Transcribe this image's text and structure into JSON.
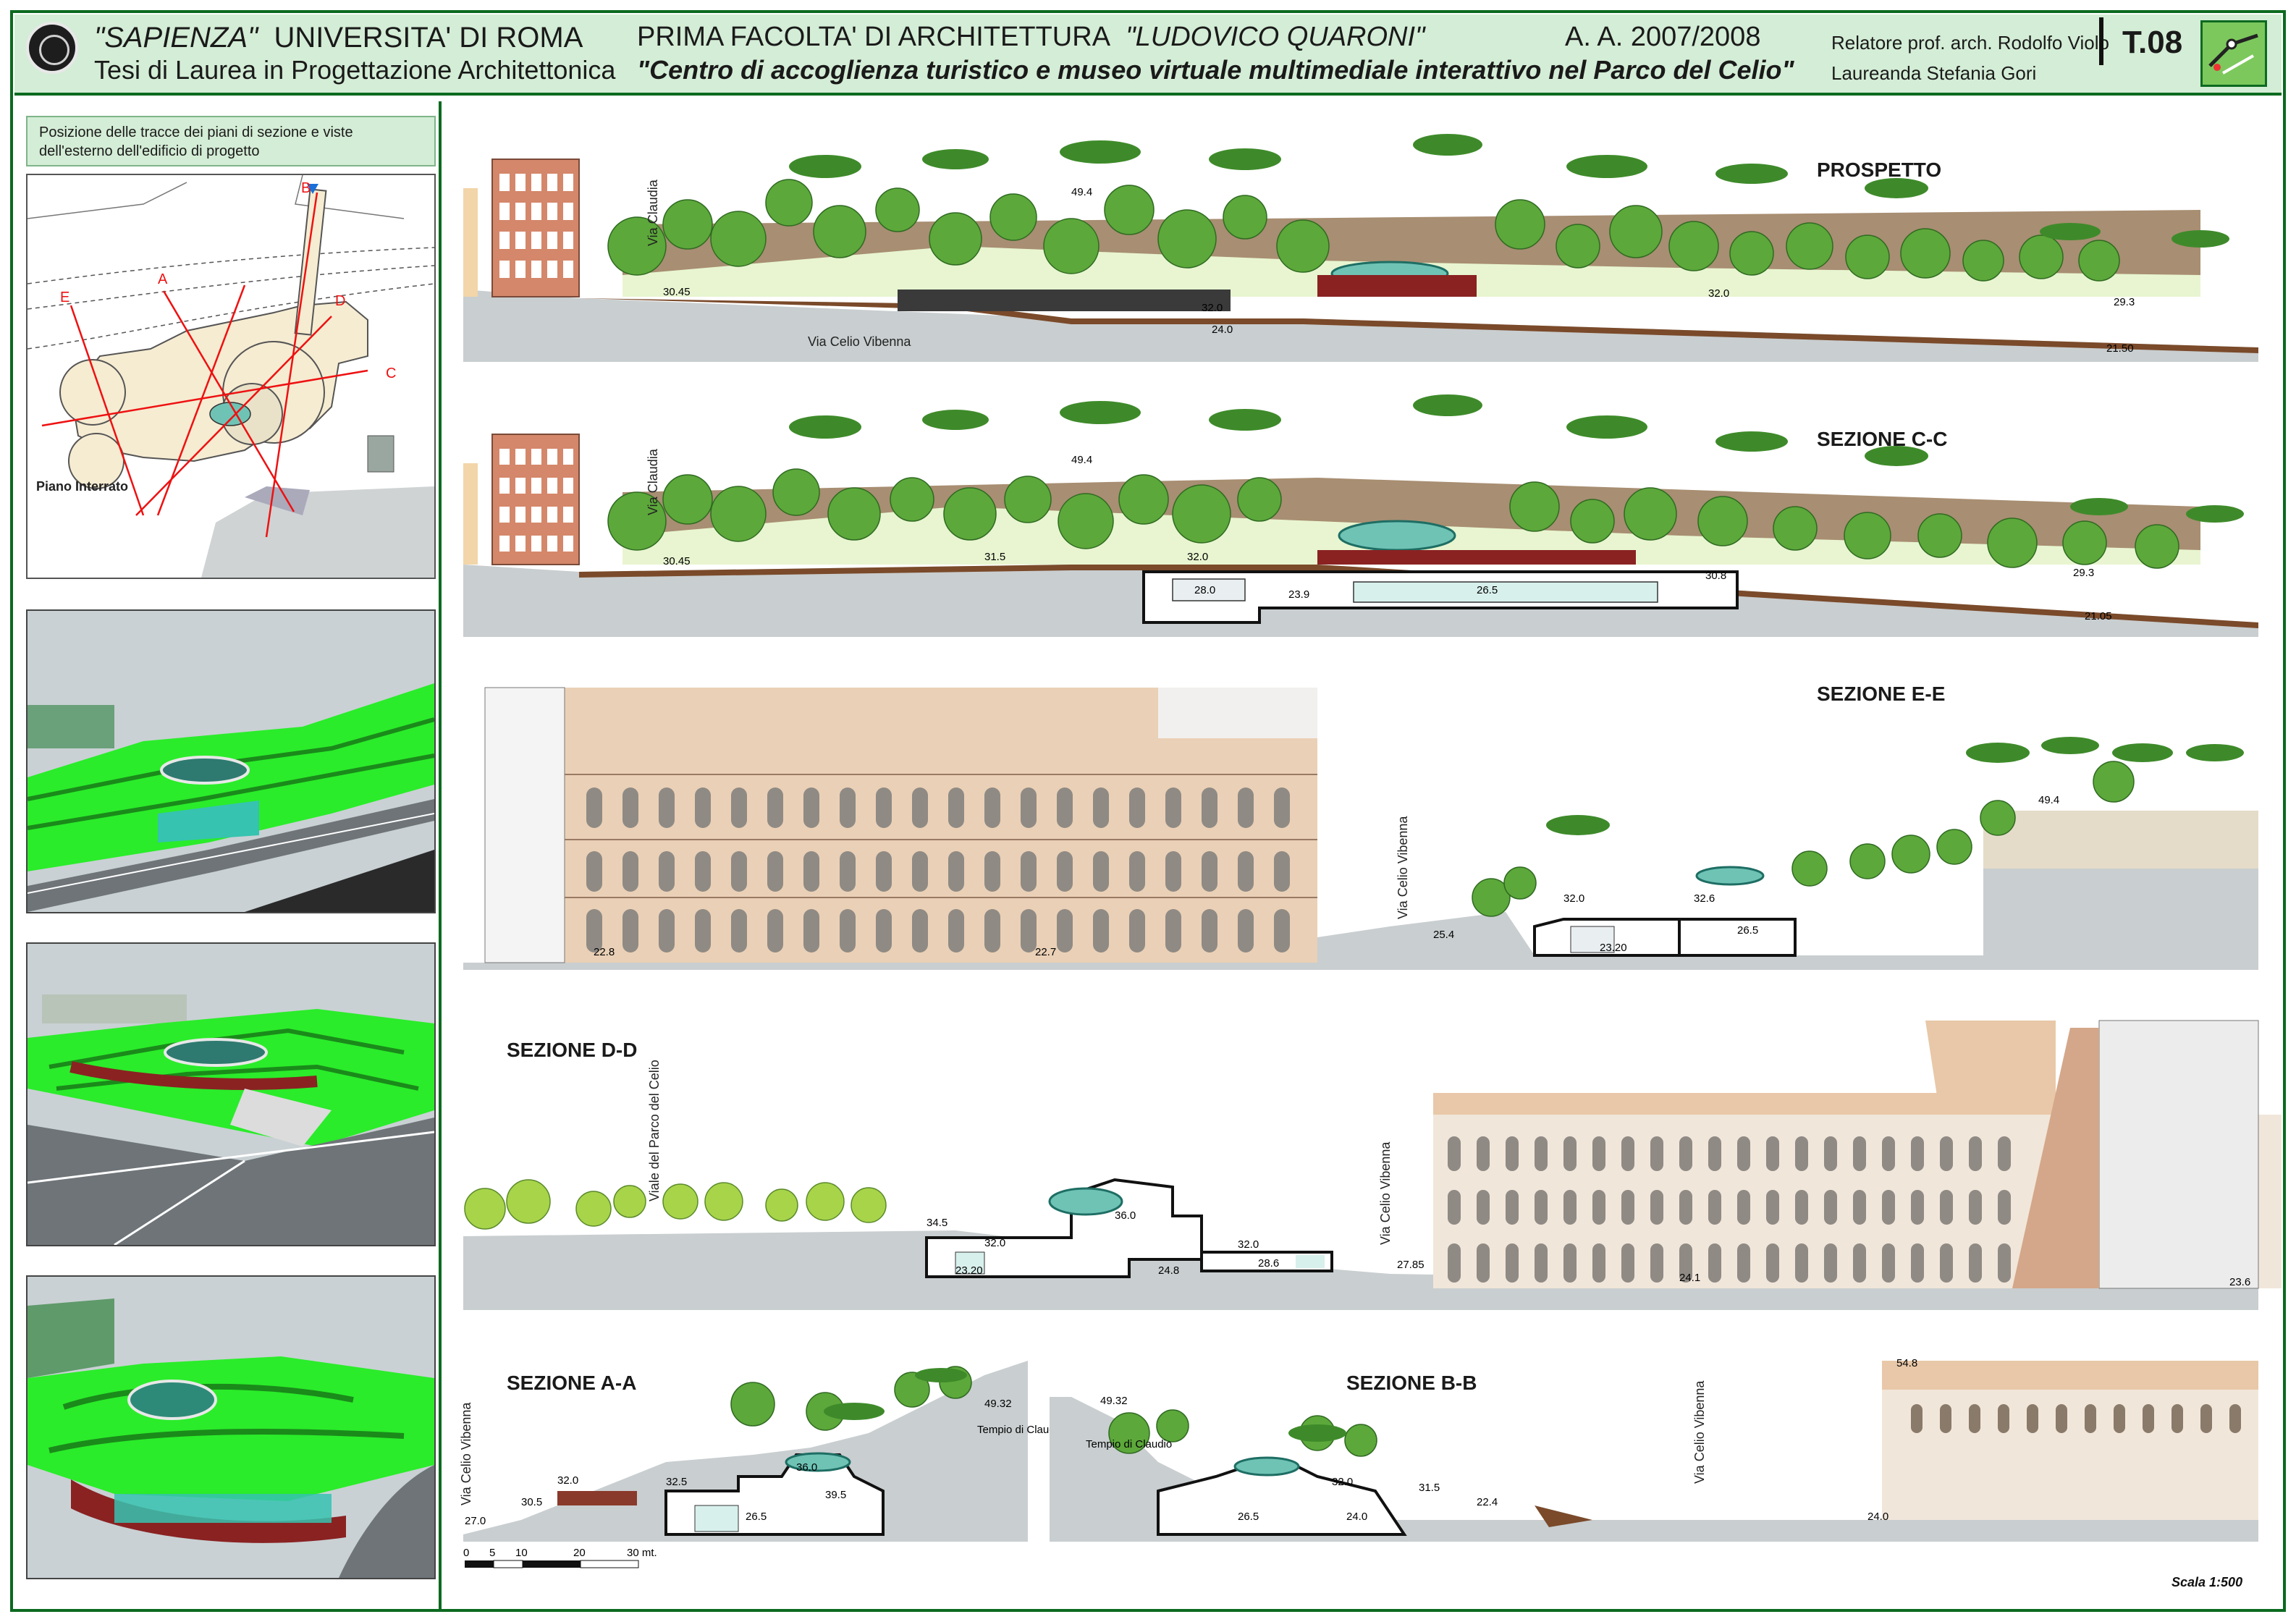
{
  "header": {
    "university_name": "\"SAPIENZA\"",
    "university_rest": "UNIVERSITA' DI ROMA",
    "thesis_line": "Tesi di Laurea in Progettazione Architettonica",
    "faculty_prefix": "PRIMA FACOLTA' DI ARCHITETTURA",
    "faculty_name": "\"LUDOVICO QUARONI\"",
    "academic_year": "A. A. 2007/2008",
    "project_title": "\"Centro di accoglienza turistico e museo virtuale multimediale interattivo nel Parco del Celio\"",
    "supervisor": "Relatore prof. arch. Rodolfo Violo",
    "student": "Laureanda Stefania Gori",
    "sheet_number": "T.08"
  },
  "left_panel": {
    "caption": "Posizione delle tracce dei piani di sezione e viste dell'esterno dell'edificio di progetto",
    "plan_label": "Piano Interrato",
    "section_letters": [
      "A",
      "B",
      "C",
      "D",
      "E"
    ]
  },
  "drawings": {
    "prospetto": {
      "title": "PROSPETTO",
      "street_1": "Via Claudia",
      "street_2": "Via Celio Vibenna",
      "levels": [
        "30.45",
        "49.4",
        "32.0",
        "24.0",
        "32.0",
        "29.3",
        "21.50"
      ]
    },
    "sezione_cc": {
      "title": "SEZIONE C-C",
      "street_1": "Via Claudia",
      "levels": [
        "30.45",
        "49.4",
        "31.5",
        "32.0",
        "28.0",
        "26.5",
        "30.8",
        "29.3",
        "21.05",
        "23.9"
      ]
    },
    "sezione_ee": {
      "title": "SEZIONE E-E",
      "street": "Via Celio Vibenna",
      "levels": [
        "22.8",
        "22.7",
        "25.4",
        "32.0",
        "32.6",
        "26.5",
        "23.20",
        "49.4"
      ]
    },
    "sezione_dd": {
      "title": "SEZIONE D-D",
      "street_1": "Viale del Parco del Celio",
      "street_2": "Via Celio Vibenna",
      "levels": [
        "34.5",
        "32.0",
        "36.0",
        "32.0",
        "28.6",
        "24.8",
        "23.20",
        "27.85",
        "24.1",
        "23.6"
      ]
    },
    "sezione_aa": {
      "title": "SEZIONE A-A",
      "street": "Via Celio Vibenna",
      "temple": "Tempio di Claudio",
      "levels": [
        "27.0",
        "32.0",
        "30.5",
        "32.5",
        "36.0",
        "39.5",
        "26.5",
        "49.32"
      ]
    },
    "sezione_bb": {
      "title": "SEZIONE B-B",
      "street": "Via Celio Vibenna",
      "temple": "Tempio di Claudio",
      "levels": [
        "49.32",
        "32.0",
        "31.5",
        "26.5",
        "24.0",
        "22.4",
        "24.0",
        "54.8"
      ]
    }
  },
  "scale_bar": {
    "ticks": [
      "0",
      "5",
      "10",
      "20",
      "30 mt."
    ],
    "scale_text": "Scala 1:500"
  },
  "colors": {
    "frame": "#0c6a20",
    "header_bg": "#d4edd6",
    "ground": "#c9ced0",
    "earth": "#7a4a2a",
    "tree": "#5ca83a",
    "colosseum": "#e8c8a8",
    "glass": "#6fc3b5"
  }
}
